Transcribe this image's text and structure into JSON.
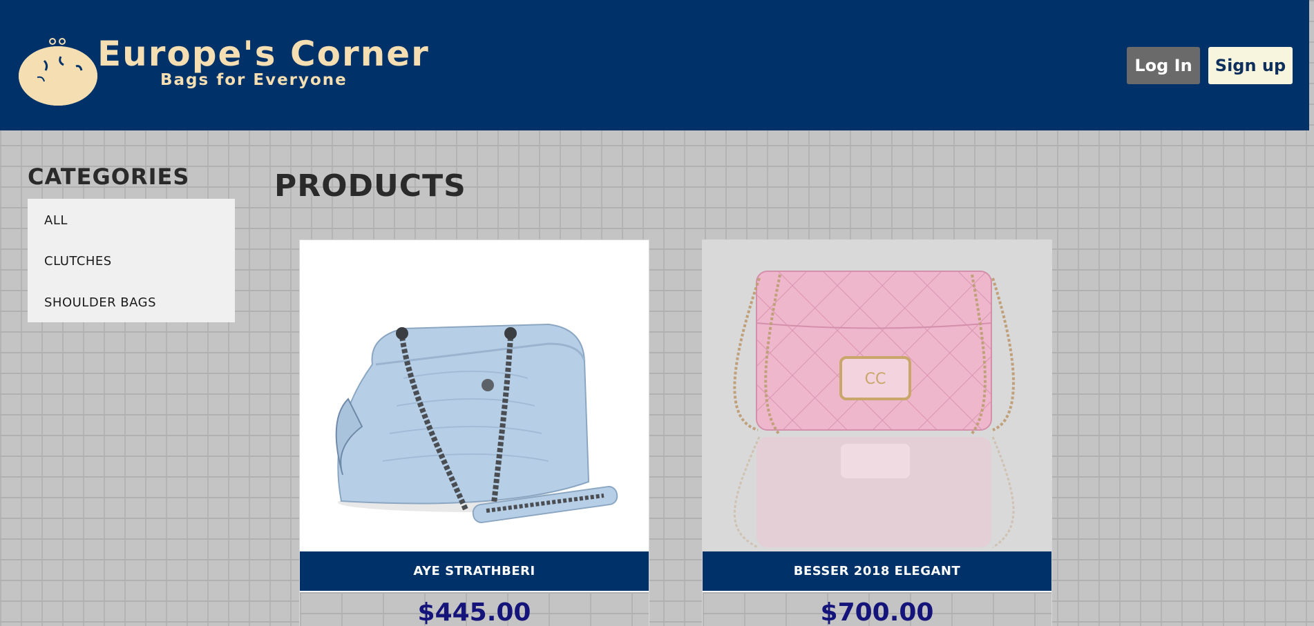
{
  "header": {
    "logo_title": "Europe's Corner",
    "logo_tagline": "Bags for Everyone",
    "login_label": "Log In",
    "signup_label": "Sign up"
  },
  "sidebar": {
    "title": "CATEGORIES",
    "items": [
      {
        "label": "ALL"
      },
      {
        "label": "CLUTCHES"
      },
      {
        "label": "SHOULDER BAGS"
      }
    ]
  },
  "main": {
    "title": "PRODUCTS",
    "products": [
      {
        "name": "AYE STRATHBERI",
        "price": "$445.00",
        "image": "light-blue-quilted-chain-handbag"
      },
      {
        "name": "BESSER 2018 ELEGANT",
        "price": "$700.00",
        "image": "pink-quilted-chain-flap-bag"
      }
    ]
  },
  "colors": {
    "header_bg": "#003269",
    "logo": "#f5dfb2",
    "price": "#14147a",
    "login_bg": "#6a6a6a",
    "signup_bg": "#f7f5dd"
  }
}
